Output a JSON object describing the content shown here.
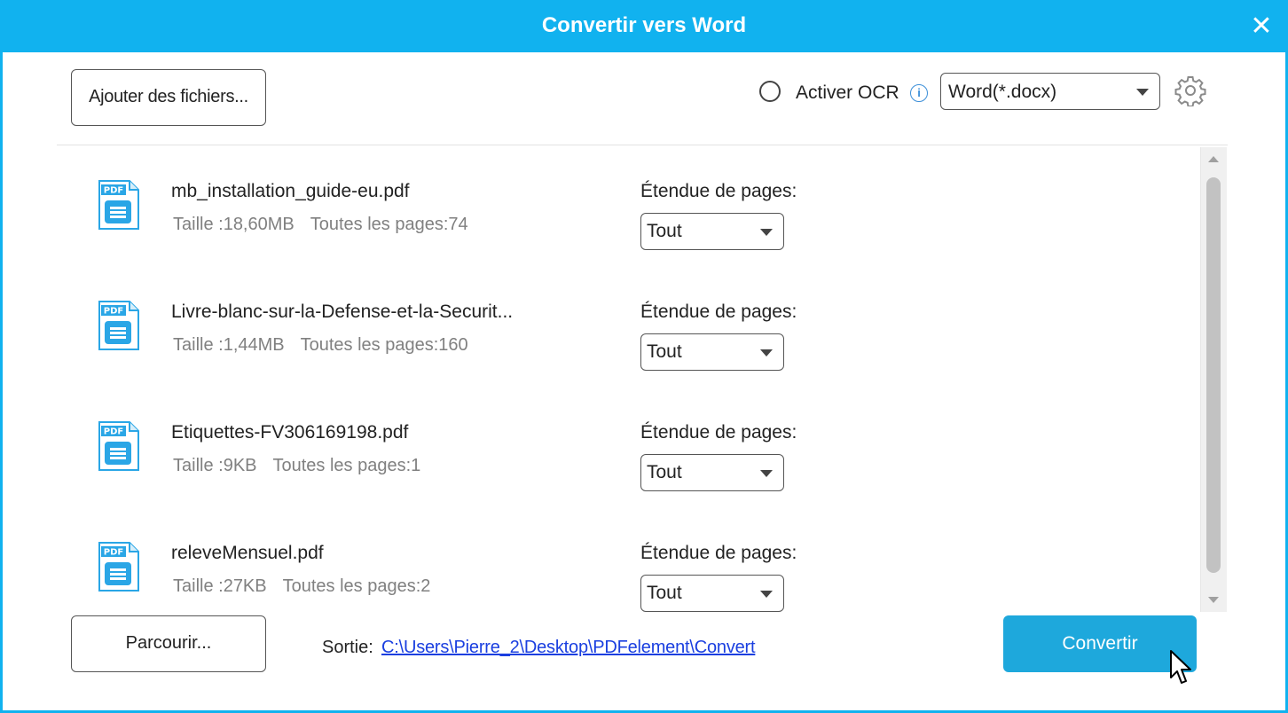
{
  "window": {
    "title": "Convertir vers Word",
    "close_glyph": "✕"
  },
  "toolbar": {
    "add_files_label": "Ajouter des fichiers...",
    "ocr_label": "Activer OCR",
    "ocr_checked": false,
    "info_glyph": "i",
    "format_value": "Word(*.docx)",
    "settings_icon": "gear-icon"
  },
  "files": [
    {
      "name": "mb_installation_guide-eu.pdf",
      "size": "Taille :18,60MB",
      "pages": "Toutes les pages:74",
      "range_label": "Étendue de pages:",
      "range_value": "Tout"
    },
    {
      "name": "Livre-blanc-sur-la-Defense-et-la-Securit...",
      "size": "Taille :1,44MB",
      "pages": "Toutes les pages:160",
      "range_label": "Étendue de pages:",
      "range_value": "Tout"
    },
    {
      "name": "Etiquettes-FV306169198.pdf",
      "size": "Taille :9KB",
      "pages": "Toutes les pages:1",
      "range_label": "Étendue de pages:",
      "range_value": "Tout"
    },
    {
      "name": "releveMensuel.pdf",
      "size": "Taille :27KB",
      "pages": "Toutes les pages:2",
      "range_label": "Étendue de pages:",
      "range_value": "Tout"
    }
  ],
  "pdf_icon_text": "PDF",
  "footer": {
    "browse_label": "Parcourir...",
    "output_label": "Sortie:",
    "output_path": "C:\\Users\\Pierre_2\\Desktop\\PDFelement\\Convert",
    "convert_label": "Convertir"
  },
  "colors": {
    "title_bar": "#11b2ef",
    "convert_button": "#1ea8dc",
    "link": "#1a3fe0",
    "pdf_icon": "#2aa6e6"
  }
}
